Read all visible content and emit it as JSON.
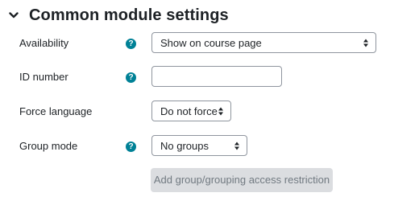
{
  "section": {
    "title": "Common module settings",
    "expanded_icon": "chevron-down-icon"
  },
  "fields": {
    "availability": {
      "label": "Availability",
      "selected": "Show on course page",
      "has_help": true
    },
    "id_number": {
      "label": "ID number",
      "value": "",
      "has_help": true
    },
    "force_language": {
      "label": "Force language",
      "selected": "Do not force",
      "has_help": false
    },
    "group_mode": {
      "label": "Group mode",
      "selected": "No groups",
      "has_help": true
    }
  },
  "help_icon": {
    "glyph": "?",
    "color": "#008196"
  },
  "add_restriction_button": {
    "label": "Add group/grouping access restriction",
    "disabled": true
  }
}
